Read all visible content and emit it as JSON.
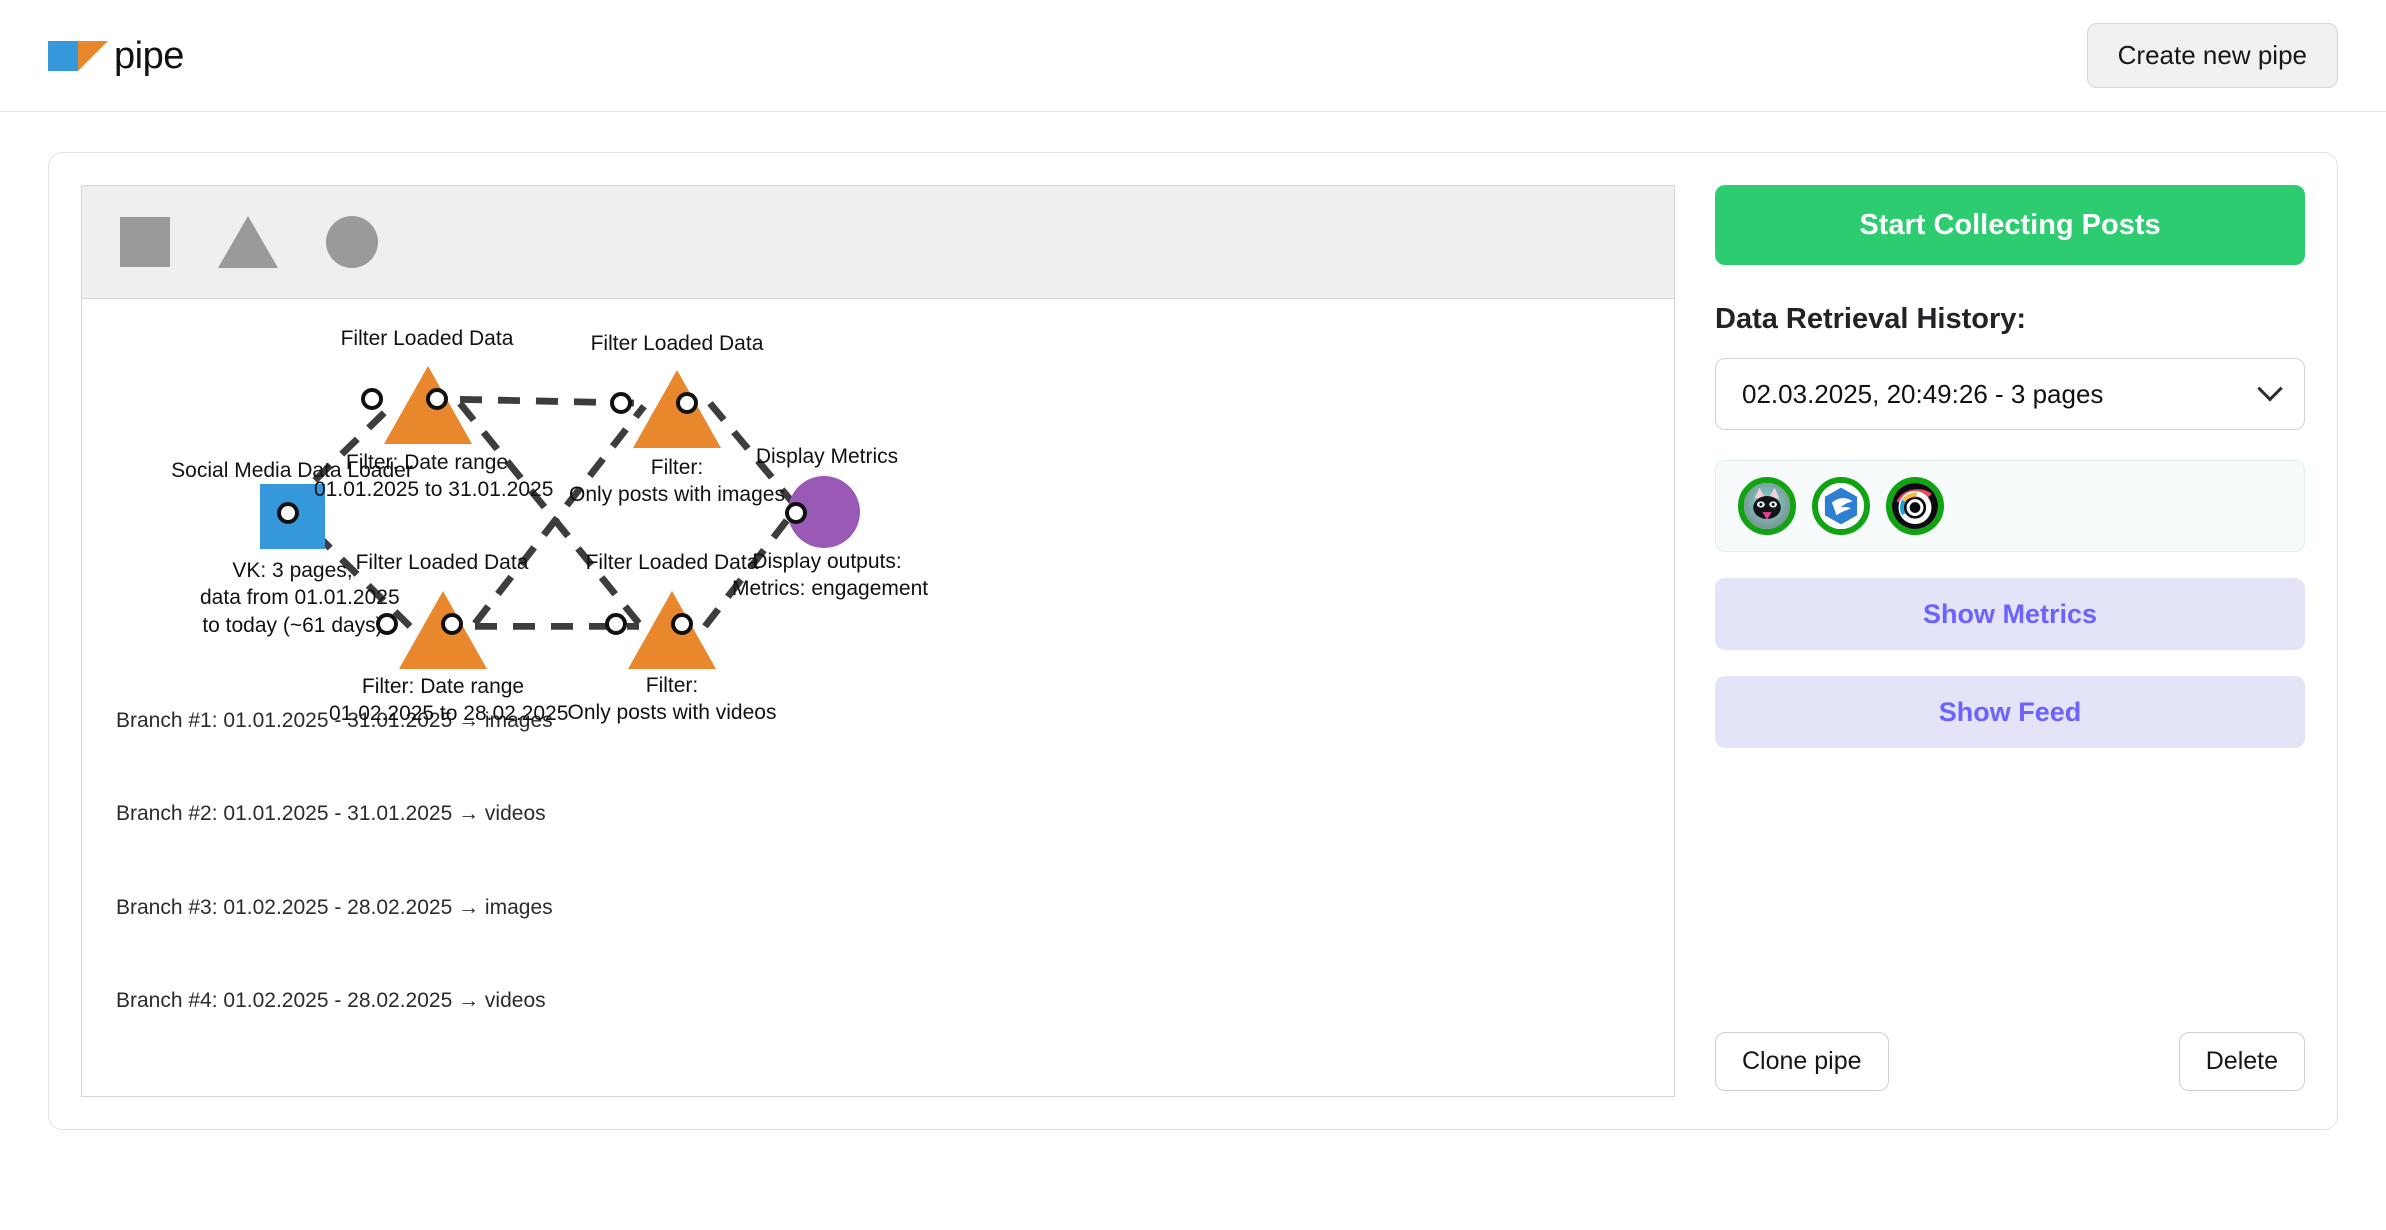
{
  "header": {
    "brand_text": "pipe",
    "create_button": "Create new pipe"
  },
  "palette": {
    "square_label": "square-shape-tool",
    "triangle_label": "triangle-shape-tool",
    "circle_label": "circle-shape-tool"
  },
  "diagram": {
    "nodes": [
      {
        "id": "loader",
        "type": "square",
        "title": "Social Media Data Loader",
        "caption": "VK: 3 pages,\ndata from 01.01.2025\nto today (~61 days)",
        "color": "#3498db"
      },
      {
        "id": "filter1",
        "type": "triangle",
        "title": "Filter Loaded Data",
        "caption": "Filter: Date range\n01.01.2025 to 31.01.2025",
        "color": "#e8872c"
      },
      {
        "id": "filter2",
        "type": "triangle",
        "title": "Filter Loaded Data",
        "caption": "Filter:\nOnly posts with images",
        "color": "#e8872c"
      },
      {
        "id": "filter3",
        "type": "triangle",
        "title": "Filter Loaded Data",
        "caption": "Filter: Date range\n01.02.2025 to 28.02.2025",
        "color": "#e8872c"
      },
      {
        "id": "filter4",
        "type": "triangle",
        "title": "Filter Loaded Data",
        "caption": "Filter:\nOnly posts with videos",
        "color": "#e8872c"
      },
      {
        "id": "metrics",
        "type": "circle",
        "title": "Display Metrics",
        "caption": "Display outputs:\nMetrics: engagement",
        "color": "#9b59b6"
      }
    ],
    "branches": [
      "Branch #1: 01.01.2025 - 31.01.2025 → images",
      "Branch #2: 01.01.2025 - 31.01.2025 → videos",
      "Branch #3: 01.02.2025 - 28.02.2025 → images",
      "Branch #4: 01.02.2025 - 28.02.2025 → videos"
    ]
  },
  "sidebar": {
    "start_button": "Start Collecting Posts",
    "history_title": "Data Retrieval History:",
    "history_selected": "02.03.2025, 20:49:26 - 3 pages",
    "avatars": [
      {
        "name": "cat-avatar"
      },
      {
        "name": "bird-logo-avatar"
      },
      {
        "name": "camera-ring-avatar"
      }
    ],
    "show_metrics_button": "Show Metrics",
    "show_feed_button": "Show Feed",
    "clone_button": "Clone pipe",
    "delete_button": "Delete"
  },
  "colors": {
    "accent_green": "#2ecc71",
    "accent_purple": "#6c63ff",
    "node_blue": "#3498db",
    "node_orange": "#e8872c",
    "node_violet": "#9b59b6",
    "ring_green": "#12a312"
  }
}
